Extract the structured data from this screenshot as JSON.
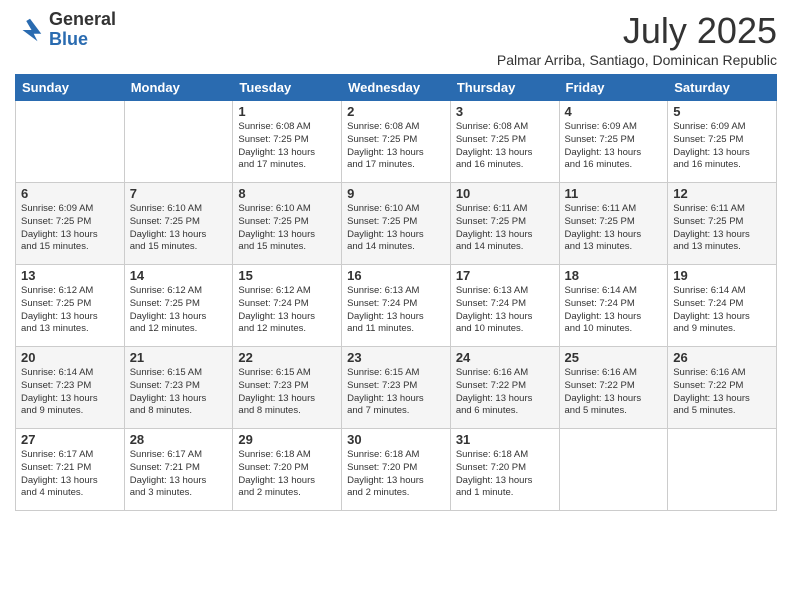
{
  "logo": {
    "general": "General",
    "blue": "Blue"
  },
  "title": "July 2025",
  "subtitle": "Palmar Arriba, Santiago, Dominican Republic",
  "days_of_week": [
    "Sunday",
    "Monday",
    "Tuesday",
    "Wednesday",
    "Thursday",
    "Friday",
    "Saturday"
  ],
  "weeks": [
    [
      {
        "day": "",
        "info": ""
      },
      {
        "day": "",
        "info": ""
      },
      {
        "day": "1",
        "info": "Sunrise: 6:08 AM\nSunset: 7:25 PM\nDaylight: 13 hours\nand 17 minutes."
      },
      {
        "day": "2",
        "info": "Sunrise: 6:08 AM\nSunset: 7:25 PM\nDaylight: 13 hours\nand 17 minutes."
      },
      {
        "day": "3",
        "info": "Sunrise: 6:08 AM\nSunset: 7:25 PM\nDaylight: 13 hours\nand 16 minutes."
      },
      {
        "day": "4",
        "info": "Sunrise: 6:09 AM\nSunset: 7:25 PM\nDaylight: 13 hours\nand 16 minutes."
      },
      {
        "day": "5",
        "info": "Sunrise: 6:09 AM\nSunset: 7:25 PM\nDaylight: 13 hours\nand 16 minutes."
      }
    ],
    [
      {
        "day": "6",
        "info": "Sunrise: 6:09 AM\nSunset: 7:25 PM\nDaylight: 13 hours\nand 15 minutes."
      },
      {
        "day": "7",
        "info": "Sunrise: 6:10 AM\nSunset: 7:25 PM\nDaylight: 13 hours\nand 15 minutes."
      },
      {
        "day": "8",
        "info": "Sunrise: 6:10 AM\nSunset: 7:25 PM\nDaylight: 13 hours\nand 15 minutes."
      },
      {
        "day": "9",
        "info": "Sunrise: 6:10 AM\nSunset: 7:25 PM\nDaylight: 13 hours\nand 14 minutes."
      },
      {
        "day": "10",
        "info": "Sunrise: 6:11 AM\nSunset: 7:25 PM\nDaylight: 13 hours\nand 14 minutes."
      },
      {
        "day": "11",
        "info": "Sunrise: 6:11 AM\nSunset: 7:25 PM\nDaylight: 13 hours\nand 13 minutes."
      },
      {
        "day": "12",
        "info": "Sunrise: 6:11 AM\nSunset: 7:25 PM\nDaylight: 13 hours\nand 13 minutes."
      }
    ],
    [
      {
        "day": "13",
        "info": "Sunrise: 6:12 AM\nSunset: 7:25 PM\nDaylight: 13 hours\nand 13 minutes."
      },
      {
        "day": "14",
        "info": "Sunrise: 6:12 AM\nSunset: 7:25 PM\nDaylight: 13 hours\nand 12 minutes."
      },
      {
        "day": "15",
        "info": "Sunrise: 6:12 AM\nSunset: 7:24 PM\nDaylight: 13 hours\nand 12 minutes."
      },
      {
        "day": "16",
        "info": "Sunrise: 6:13 AM\nSunset: 7:24 PM\nDaylight: 13 hours\nand 11 minutes."
      },
      {
        "day": "17",
        "info": "Sunrise: 6:13 AM\nSunset: 7:24 PM\nDaylight: 13 hours\nand 10 minutes."
      },
      {
        "day": "18",
        "info": "Sunrise: 6:14 AM\nSunset: 7:24 PM\nDaylight: 13 hours\nand 10 minutes."
      },
      {
        "day": "19",
        "info": "Sunrise: 6:14 AM\nSunset: 7:24 PM\nDaylight: 13 hours\nand 9 minutes."
      }
    ],
    [
      {
        "day": "20",
        "info": "Sunrise: 6:14 AM\nSunset: 7:23 PM\nDaylight: 13 hours\nand 9 minutes."
      },
      {
        "day": "21",
        "info": "Sunrise: 6:15 AM\nSunset: 7:23 PM\nDaylight: 13 hours\nand 8 minutes."
      },
      {
        "day": "22",
        "info": "Sunrise: 6:15 AM\nSunset: 7:23 PM\nDaylight: 13 hours\nand 8 minutes."
      },
      {
        "day": "23",
        "info": "Sunrise: 6:15 AM\nSunset: 7:23 PM\nDaylight: 13 hours\nand 7 minutes."
      },
      {
        "day": "24",
        "info": "Sunrise: 6:16 AM\nSunset: 7:22 PM\nDaylight: 13 hours\nand 6 minutes."
      },
      {
        "day": "25",
        "info": "Sunrise: 6:16 AM\nSunset: 7:22 PM\nDaylight: 13 hours\nand 5 minutes."
      },
      {
        "day": "26",
        "info": "Sunrise: 6:16 AM\nSunset: 7:22 PM\nDaylight: 13 hours\nand 5 minutes."
      }
    ],
    [
      {
        "day": "27",
        "info": "Sunrise: 6:17 AM\nSunset: 7:21 PM\nDaylight: 13 hours\nand 4 minutes."
      },
      {
        "day": "28",
        "info": "Sunrise: 6:17 AM\nSunset: 7:21 PM\nDaylight: 13 hours\nand 3 minutes."
      },
      {
        "day": "29",
        "info": "Sunrise: 6:18 AM\nSunset: 7:20 PM\nDaylight: 13 hours\nand 2 minutes."
      },
      {
        "day": "30",
        "info": "Sunrise: 6:18 AM\nSunset: 7:20 PM\nDaylight: 13 hours\nand 2 minutes."
      },
      {
        "day": "31",
        "info": "Sunrise: 6:18 AM\nSunset: 7:20 PM\nDaylight: 13 hours\nand 1 minute."
      },
      {
        "day": "",
        "info": ""
      },
      {
        "day": "",
        "info": ""
      }
    ]
  ]
}
